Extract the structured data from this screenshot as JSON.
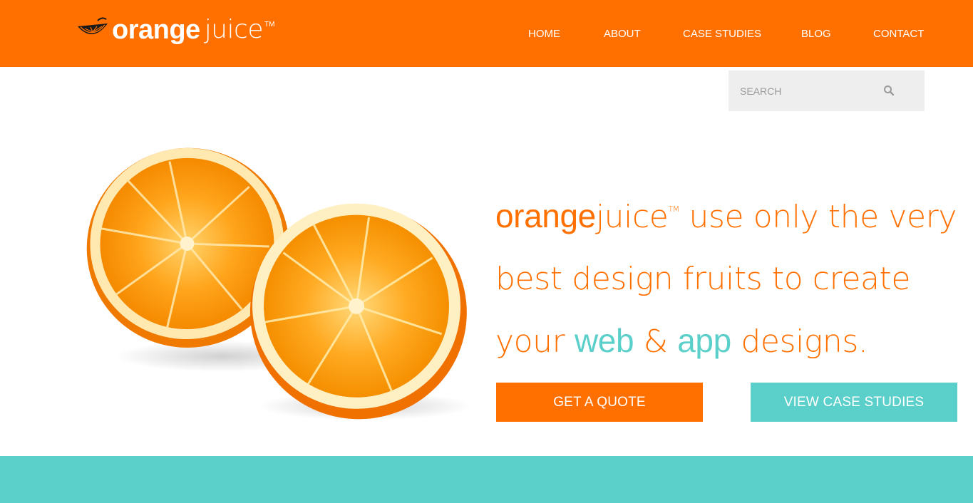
{
  "colors": {
    "brand_orange": "#ff7000",
    "accent_teal": "#5bcfc9",
    "search_bg": "#eeeeee"
  },
  "header": {
    "logo": {
      "bold": "orange",
      "light": "juice",
      "tm": "TM",
      "icon": "orange-slice-icon"
    },
    "nav": [
      "HOME",
      "ABOUT",
      "CASE STUDIES",
      "BLOG",
      "CONTACT"
    ]
  },
  "search": {
    "placeholder": "SEARCH",
    "value": "",
    "icon": "search-icon"
  },
  "hero": {
    "image": "orange-halves-image",
    "headline": {
      "brand_bold": "orange",
      "brand_light": "juice",
      "tm": "TM",
      "line1_rest": " use only the very",
      "line2": "best design fruits to create",
      "line3_a": "your ",
      "highlight_web": "web",
      "line3_b": " & ",
      "highlight_app": "app",
      "line3_c": " designs."
    },
    "buttons": {
      "quote": "GET A QUOTE",
      "cases": "VIEW CASE STUDIES"
    }
  }
}
